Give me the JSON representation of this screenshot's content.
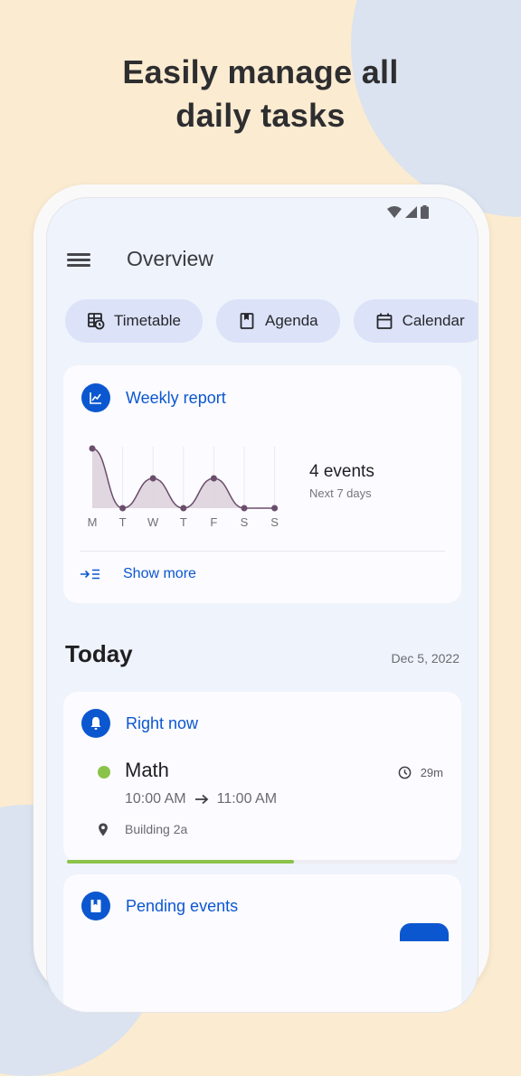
{
  "promo": {
    "headline_line1": "Easily manage all",
    "headline_line2": "daily tasks"
  },
  "status_bar": {
    "icons": [
      "wifi-icon",
      "cellular-signal-icon",
      "battery-icon"
    ]
  },
  "topbar": {
    "menu_icon": "hamburger-menu-icon",
    "title": "Overview"
  },
  "chips": [
    {
      "label": "Timetable",
      "icon": "timetable-icon"
    },
    {
      "label": "Agenda",
      "icon": "agenda-book-icon"
    },
    {
      "label": "Calendar",
      "icon": "calendar-icon"
    }
  ],
  "weekly_report": {
    "title": "Weekly report",
    "icon": "chart-line-icon",
    "events_count": "4 events",
    "events_subtitle": "Next 7 days",
    "show_more_label": "Show more",
    "show_more_icon": "expand-list-icon"
  },
  "chart_data": {
    "type": "area",
    "title": "Weekly report",
    "categories": [
      "M",
      "T",
      "W",
      "T",
      "F",
      "S",
      "S"
    ],
    "values": [
      2,
      0,
      1,
      0,
      1,
      0,
      0
    ],
    "xlabel": "",
    "ylabel": "",
    "ylim": [
      0,
      2
    ],
    "grid": true,
    "legend": "none",
    "color": "#6b4d6c"
  },
  "today": {
    "title": "Today",
    "date": "Dec 5, 2022"
  },
  "right_now": {
    "title": "Right now",
    "icon": "bell-icon",
    "event_name": "Math",
    "event_color": "#8bc34a",
    "start_time": "10:00 AM",
    "end_time": "11:00 AM",
    "remaining": "29m",
    "location": "Building 2a",
    "progress_fraction": 0.58
  },
  "pending_events": {
    "title": "Pending events",
    "icon": "bookmark-book-icon"
  }
}
